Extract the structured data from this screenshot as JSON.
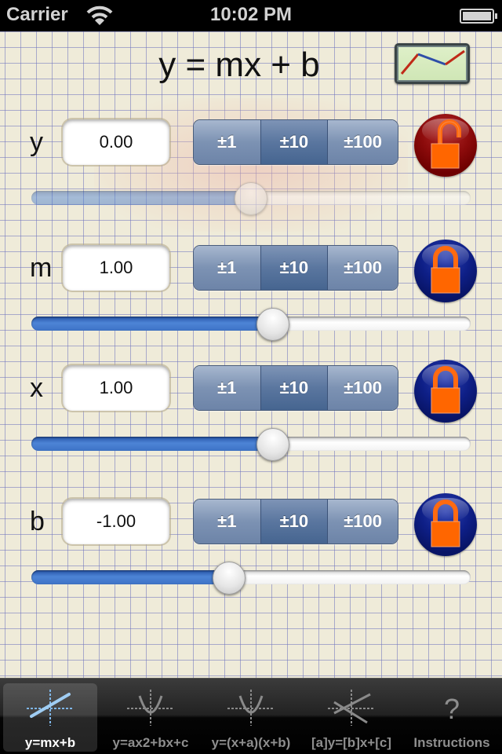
{
  "status_bar": {
    "carrier": "Carrier",
    "time": "10:02 PM",
    "wifi_icon": "wifi-icon",
    "battery_icon": "battery-icon"
  },
  "header": {
    "title": "y = mx + b",
    "graph_button_icon": "line-graph-icon"
  },
  "colors": {
    "segment_blue": "#7c92b3",
    "segment_selected": "#5a769f",
    "lock_unlocked": "#8c0b0b",
    "lock_locked": "#0e1f87",
    "padlock_orange": "#ff6600",
    "slider_fill": "#4d84d6",
    "paper": "#efebd9",
    "grid_line": "#6e73be"
  },
  "rows": [
    {
      "variable": "y",
      "value": "0.00",
      "increments": [
        "±1",
        "±10",
        "±100"
      ],
      "selected_increment": "±10",
      "lock_state": "unlocked",
      "lock_icon": "unlocked-padlock-icon",
      "slider_fraction": 0.5,
      "slider_enabled": false
    },
    {
      "variable": "m",
      "value": "1.00",
      "increments": [
        "±1",
        "±10",
        "±100"
      ],
      "selected_increment": "±10",
      "lock_state": "locked",
      "lock_icon": "locked-padlock-icon",
      "slider_fraction": 0.55,
      "slider_enabled": true
    },
    {
      "variable": "x",
      "value": "1.00",
      "increments": [
        "±1",
        "±10",
        "±100"
      ],
      "selected_increment": "±10",
      "lock_state": "locked",
      "lock_icon": "locked-padlock-icon",
      "slider_fraction": 0.55,
      "slider_enabled": true
    },
    {
      "variable": "b",
      "value": "-1.00",
      "increments": [
        "±1",
        "±10",
        "±100"
      ],
      "selected_increment": "±10",
      "lock_state": "locked",
      "lock_icon": "locked-padlock-icon",
      "slider_fraction": 0.45,
      "slider_enabled": true
    }
  ],
  "tab_bar": {
    "active_index": 0,
    "tabs": [
      {
        "label": "y=mx+b",
        "icon": "linear-graph-icon"
      },
      {
        "label": "y=ax2+bx+c",
        "icon": "parabola-icon"
      },
      {
        "label": "y=(x+a)(x+b)",
        "icon": "parabola-icon"
      },
      {
        "label": "[a]y=[b]x+[c]",
        "icon": "intersecting-lines-icon"
      },
      {
        "label": "Instructions",
        "icon": "question-mark-icon",
        "glyph": "?"
      }
    ]
  }
}
